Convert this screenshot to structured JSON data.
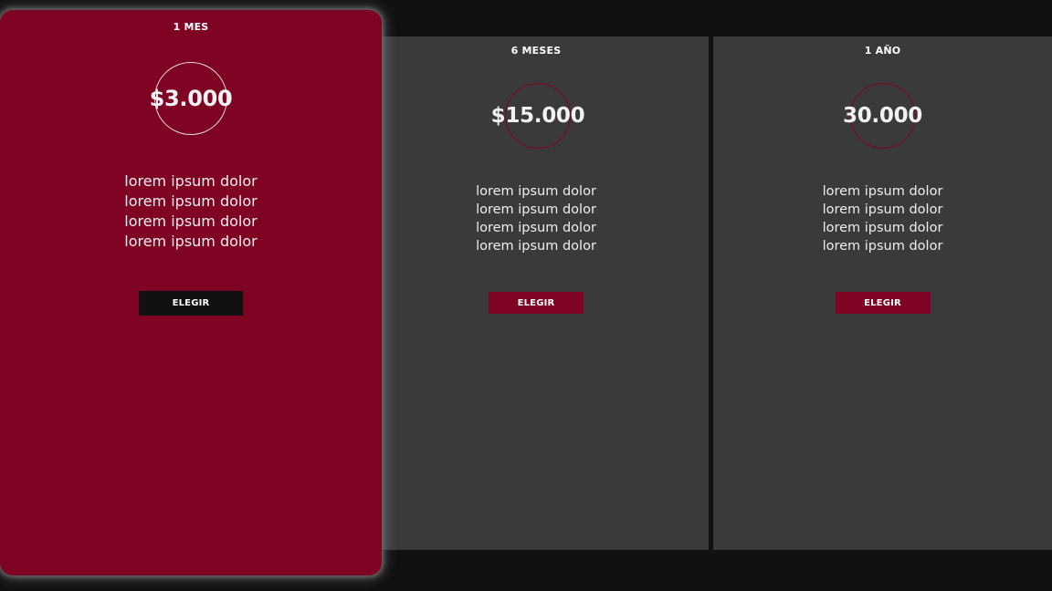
{
  "colors": {
    "background": "#111111",
    "card": "#3a3a3a",
    "accent": "#7f0424",
    "text": "#eeeeee"
  },
  "plans": [
    {
      "title": "1 MES",
      "price": "$3.000",
      "features": [
        "lorem ipsum dolor",
        "lorem ipsum dolor",
        "lorem ipsum dolor",
        "lorem ipsum dolor"
      ],
      "button_label": "ELEGIR",
      "highlighted": true
    },
    {
      "title": "6 MESES",
      "price": "$15.000",
      "features": [
        "lorem ipsum dolor",
        "lorem ipsum dolor",
        "lorem ipsum dolor",
        "lorem ipsum dolor"
      ],
      "button_label": "ELEGIR",
      "highlighted": false
    },
    {
      "title": "1 AÑO",
      "price": "30.000",
      "features": [
        "lorem ipsum dolor",
        "lorem ipsum dolor",
        "lorem ipsum dolor",
        "lorem ipsum dolor"
      ],
      "button_label": "ELEGIR",
      "highlighted": false
    }
  ]
}
